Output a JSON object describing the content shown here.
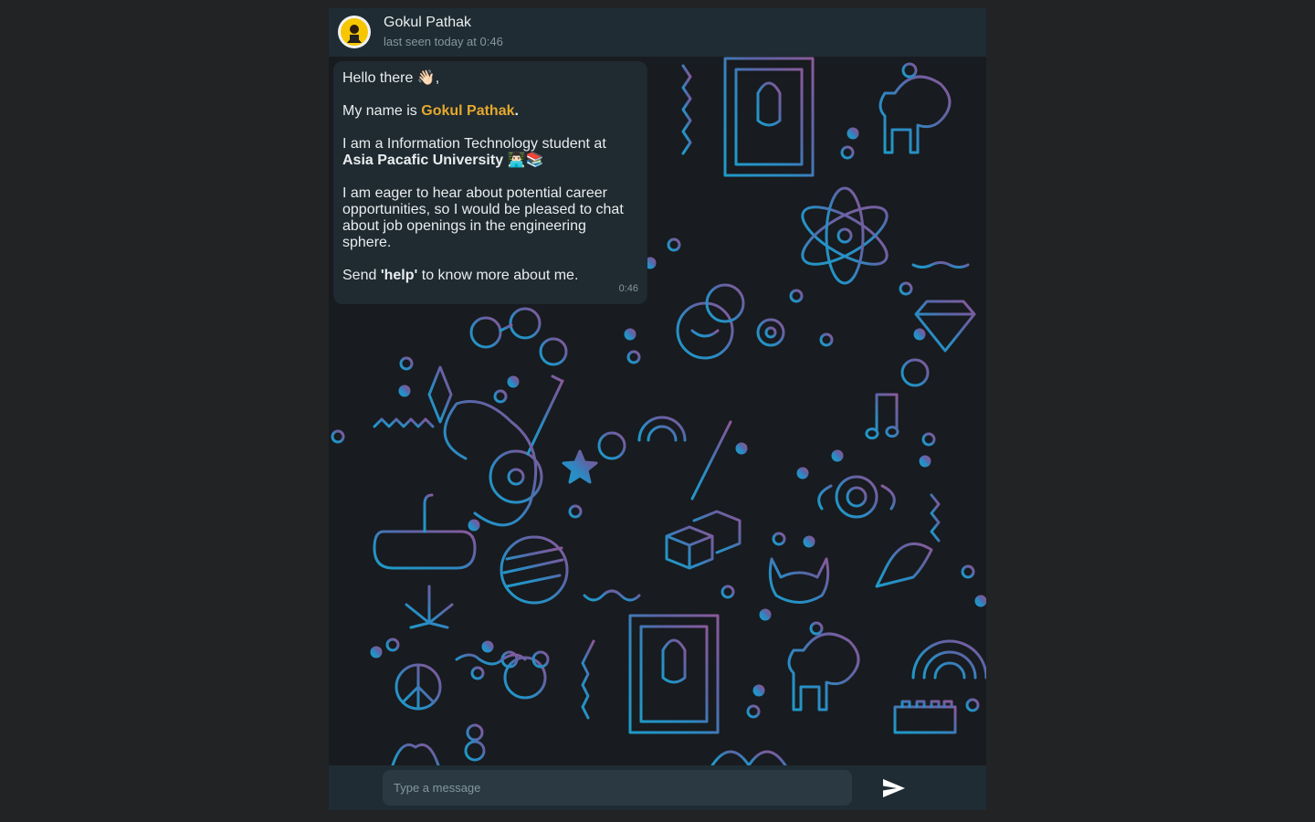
{
  "header": {
    "contact_name": "Gokul Pathak",
    "last_seen": "last seen today at 0:46"
  },
  "message": {
    "greeting": "Hello there 👋🏻,",
    "name_prefix": "My name is ",
    "name_value": "Gokul Pathak",
    "name_suffix": ".",
    "student_line": "I am a Information Technology student at",
    "university": "Asia Pacafic University",
    "university_emoji": " 👨🏻‍💻📚",
    "career_text": "I am eager to hear about potential career opportunities, so I would be pleased to chat about job openings in the engineering sphere.",
    "send_prefix": "Send ",
    "send_keyword": "'help'",
    "send_suffix": " to know more about me.",
    "time": "0:46"
  },
  "composer": {
    "placeholder": "Type a message"
  },
  "icons": {
    "send": "send-icon",
    "avatar": "avatar"
  },
  "colors": {
    "accent_name": "#e5a92c",
    "header_bg": "#1f2c33",
    "bubble_bg": "#1f2a31"
  }
}
